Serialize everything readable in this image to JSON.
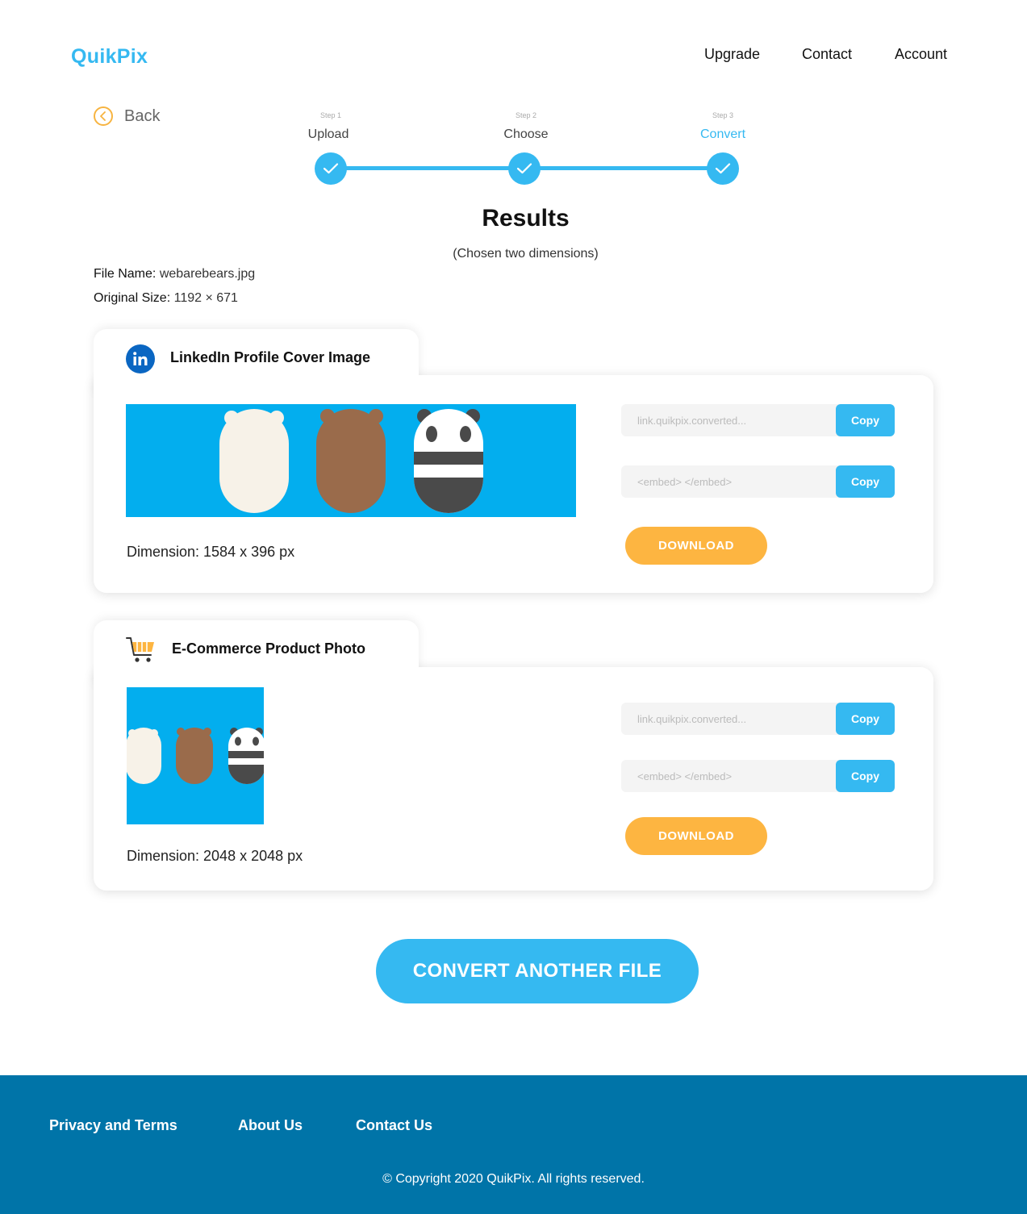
{
  "brand": {
    "name": "QuikPix",
    "accent": "#35b9f1",
    "footer_bg": "#0074a8",
    "download_color": "#fdb541"
  },
  "nav": {
    "upgrade": "Upgrade",
    "contact": "Contact",
    "account": "Account"
  },
  "back": {
    "label": "Back",
    "icon": "chevron-left-icon"
  },
  "steps": [
    {
      "small": "Step 1",
      "label": "Upload",
      "completed": true
    },
    {
      "small": "Step 2",
      "label": "Choose",
      "completed": true
    },
    {
      "small": "Step 3",
      "label": "Convert",
      "completed": true,
      "active": true
    }
  ],
  "results": {
    "title": "Results",
    "subtitle": "(Chosen two dimensions)"
  },
  "file": {
    "name_label": "File Name:",
    "name_value": "webarebears.jpg",
    "size_label": "Original Size:",
    "size_value": "1192 × 671"
  },
  "cards": [
    {
      "icon": "linkedin-icon",
      "title": "LinkedIn Profile Cover Image",
      "dimension": "Dimension: 1584 x 396 px",
      "link_placeholder": "link.quikpix.converted...",
      "embed_placeholder": "<embed> </embed>",
      "copy_label": "Copy",
      "download_label": "DOWNLOAD"
    },
    {
      "icon": "shopping-cart-icon",
      "title": "E-Commerce Product Photo",
      "dimension": "Dimension: 2048 x 2048 px",
      "link_placeholder": "link.quikpix.converted...",
      "embed_placeholder": "<embed> </embed>",
      "copy_label": "Copy",
      "download_label": "DOWNLOAD"
    }
  ],
  "cta": {
    "label": "CONVERT ANOTHER FILE"
  },
  "footer": {
    "links": [
      "Privacy and Terms",
      "About Us",
      "Contact Us"
    ],
    "copyright": "© Copyright 2020 QuikPix. All rights reserved."
  }
}
